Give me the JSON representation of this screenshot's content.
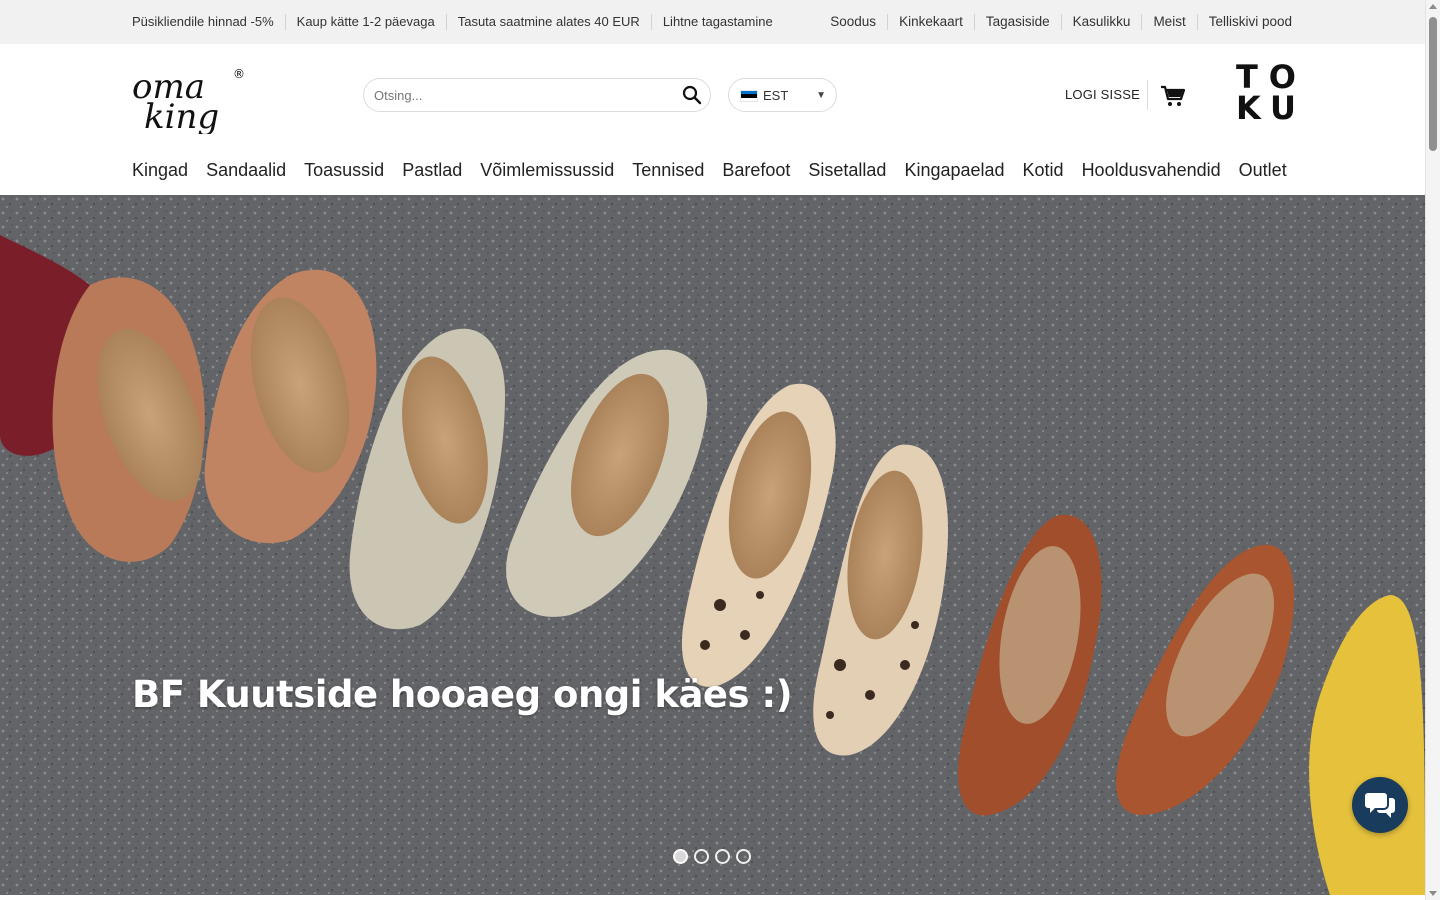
{
  "topbar": {
    "promos": [
      "Püsikliendile hinnad -5%",
      "Kaup kätte 1-2 päevaga",
      "Tasuta saatmine alates 40 EUR",
      "Lihtne tagastamine"
    ],
    "links": [
      "Soodus",
      "Kinkekaart",
      "Tagasiside",
      "Kasulikku",
      "Meist",
      "Telliskivi pood"
    ]
  },
  "header": {
    "logo_text": [
      "oma",
      "king",
      "®"
    ],
    "search": {
      "placeholder": "Otsing...",
      "icon": "search-icon"
    },
    "language": {
      "code": "EST",
      "flag_colors": [
        "#0072ce",
        "#000000",
        "#ffffff"
      ],
      "icon": "caret-down-icon"
    },
    "login_label": "LOGI SISSE",
    "cart_icon": "cart-icon",
    "partner_logo": [
      "T",
      "O",
      "K",
      "U"
    ]
  },
  "nav": {
    "items": [
      "Kingad",
      "Sandaalid",
      "Toasussid",
      "Pastlad",
      "Võimlemissussid",
      "Tennised",
      "Barefoot",
      "Sisetallad",
      "Kingapaelad",
      "Kotid",
      "Hooldusvahendid",
      "Outlet"
    ]
  },
  "hero": {
    "title": "BF Kuutside hooaeg ongi käes :)",
    "slides_count": 4,
    "active_slide": 1,
    "image_subject": "row of leather ballet flats on asphalt"
  },
  "chat": {
    "icon": "chat-bubbles-icon",
    "color": "#193b5c"
  },
  "colors": {
    "topbar_bg": "#f1f1f1",
    "text": "#222222"
  }
}
